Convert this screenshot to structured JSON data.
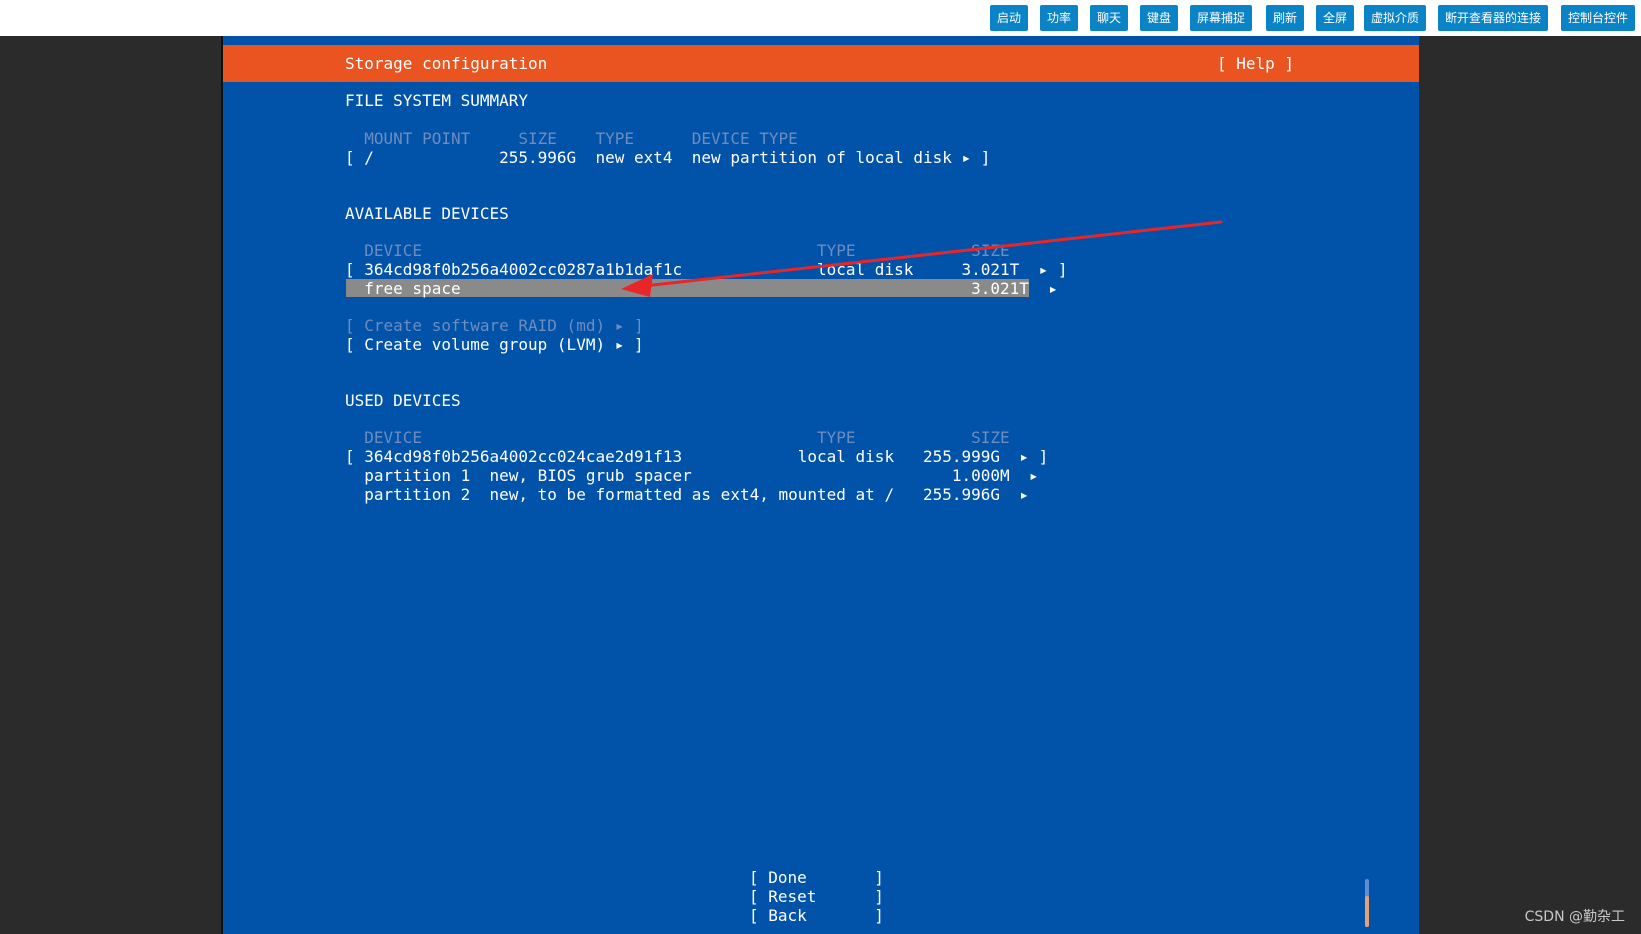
{
  "toolbar": {
    "buttons": [
      "启动",
      "功率",
      "聊天",
      "键盘",
      "屏幕捕捉",
      "刷新",
      "全屏",
      "虚拟介质",
      "断开查看器的连接",
      "控制台控件"
    ]
  },
  "header": {
    "title": "Storage configuration",
    "help": "[ Help ]"
  },
  "fs_summary": {
    "heading": "FILE SYSTEM SUMMARY",
    "columns": "  MOUNT POINT     SIZE    TYPE      DEVICE TYPE",
    "rows": [
      "[ /             255.996G  new ext4  new partition of local disk ▸ ]"
    ]
  },
  "available": {
    "heading": "AVAILABLE DEVICES",
    "columns": "  DEVICE                                         TYPE            SIZE",
    "disk_row": "[ 364cd98f0b256a4002cc0287a1b1daf1c              local disk     3.021T  ▸ ]",
    "free_row": "  free space                                                     3.021T  ▸",
    "raid": "[ Create software RAID (md) ▸ ]",
    "lvm": "[ Create volume group (LVM) ▸ ]"
  },
  "used": {
    "heading": "USED DEVICES",
    "columns": "  DEVICE                                         TYPE            SIZE",
    "rows": [
      "[ 364cd98f0b256a4002cc024cae2d91f13            local disk   255.999G  ▸ ]",
      "  partition 1  new, BIOS grub spacer                           1.000M  ▸",
      "  partition 2  new, to be formatted as ext4, mounted at /   255.996G  ▸"
    ]
  },
  "actions": {
    "done": "[ Done       ]",
    "reset": "[ Reset      ]",
    "back": "[ Back       ]"
  },
  "watermark": "CSDN @勤杂工",
  "colors": {
    "screen_bg": "#0053a8",
    "header_bg": "#e95420",
    "toolbar_button": "#0a84c6",
    "annotation_arrow": "#e8262a"
  }
}
